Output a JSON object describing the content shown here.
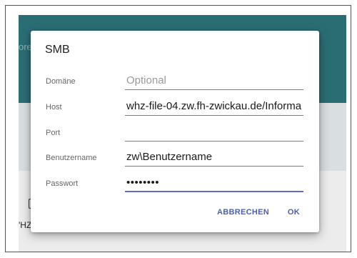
{
  "background": {
    "partial_label": "orer",
    "item_label": "'HZ-S"
  },
  "dialog": {
    "title": "SMB",
    "fields": [
      {
        "label": "Domäne",
        "value": "",
        "placeholder": "Optional",
        "type": "text"
      },
      {
        "label": "Host",
        "value": "whz-file-04.zw.fh-zwickau.de/Informa",
        "placeholder": "",
        "type": "text"
      },
      {
        "label": "Port",
        "value": "",
        "placeholder": "",
        "type": "text"
      },
      {
        "label": "Benutzername",
        "value": "zw\\Benutzername",
        "placeholder": "",
        "type": "text"
      },
      {
        "label": "Passwort",
        "value": "••••••••",
        "placeholder": "",
        "type": "password"
      }
    ],
    "cancel_label": "ABBRECHEN",
    "ok_label": "OK"
  },
  "colors": {
    "header": "#2a6e74",
    "accent": "#4d5fb5",
    "active_underline": "#5b6dbd"
  }
}
